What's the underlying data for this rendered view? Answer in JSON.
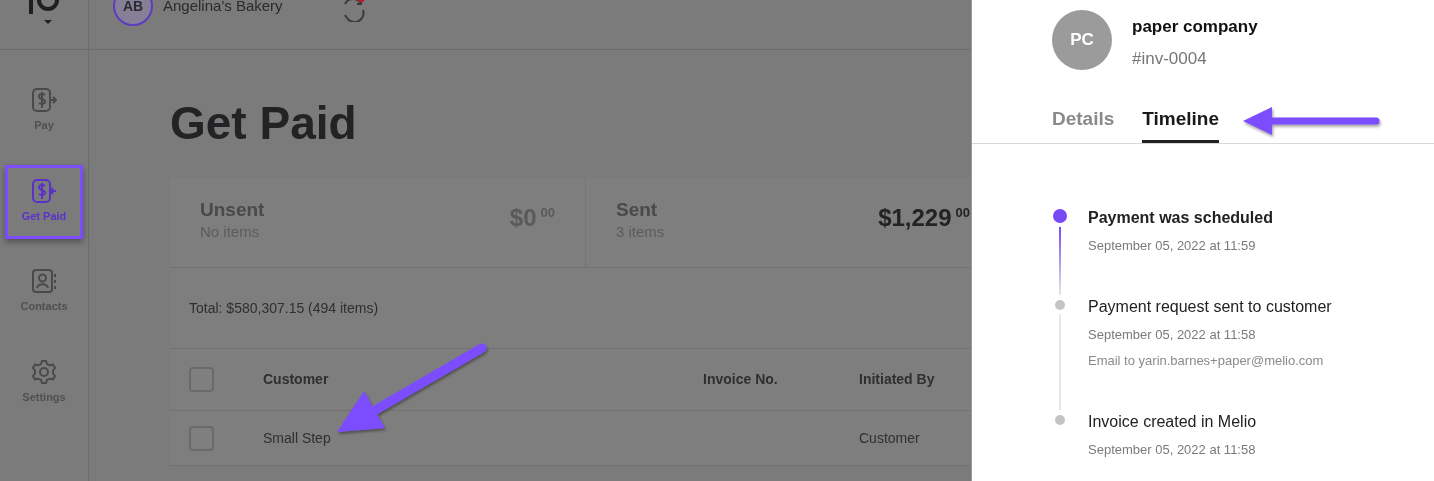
{
  "header": {
    "initials": "AB",
    "account": "Angelina's Bakery",
    "sync_alert": true
  },
  "sidebar": {
    "items": [
      {
        "label": "Pay",
        "kind": "pay",
        "selected": false
      },
      {
        "label": "Get Paid",
        "kind": "getpaid",
        "selected": true
      },
      {
        "label": "Contacts",
        "kind": "contacts",
        "selected": false
      },
      {
        "label": "Settings",
        "kind": "settings",
        "selected": false
      }
    ]
  },
  "page": {
    "title": "Get Paid",
    "summary": [
      {
        "label": "Unsent",
        "count": "No items",
        "amount": "$0",
        "cents": "00",
        "muted": true
      },
      {
        "label": "Sent",
        "count": "3 items",
        "amount": "$1,229",
        "cents": "00",
        "muted": false
      }
    ],
    "total": "Total: $580,307.15 (494 items)",
    "table": {
      "select_all": {
        "checked": false
      },
      "columns": [
        "Customer",
        "Invoice No.",
        "Initiated By"
      ],
      "rows": [
        {
          "customer": "Small Step",
          "initiated_by": "Customer",
          "checked": false
        }
      ]
    }
  },
  "drawer": {
    "initials": "PC",
    "name": "paper company",
    "invoice": "#inv-0004",
    "tabs": [
      {
        "label": "Details",
        "selected": false
      },
      {
        "label": "Timeline",
        "selected": true
      }
    ],
    "timeline": [
      {
        "title": "Payment was scheduled",
        "time": "September 05, 2022 at 11:59",
        "current": true
      },
      {
        "title": "Payment request sent to customer",
        "time": "September 05, 2022 at 11:58",
        "note": "Email to yarin.barnes+paper@melio.com",
        "current": false
      },
      {
        "title": "Invoice created in Melio",
        "time": "September 05, 2022 at 11:58",
        "current": false
      }
    ]
  }
}
